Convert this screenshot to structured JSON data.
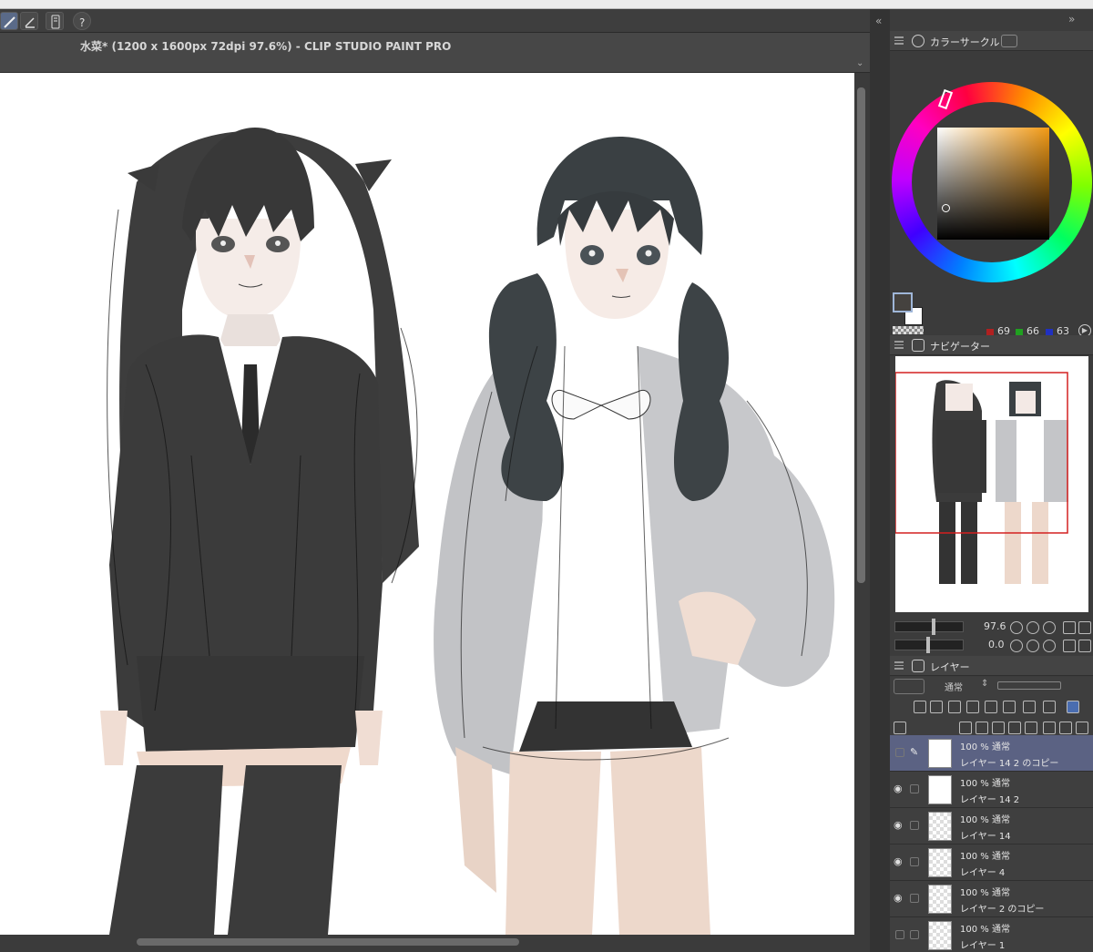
{
  "menubar": {
    "text": "",
    "clock": ""
  },
  "document": {
    "title": "水菜* (1200 x 1600px 72dpi 97.6%)  - CLIP STUDIO PAINT PRO"
  },
  "color_panel": {
    "title": "カラーサークル",
    "r": "69",
    "g": "66",
    "b": "63",
    "main_color": "#45423f",
    "accent": "#d98a1a"
  },
  "navigator": {
    "title": "ナビゲーター",
    "zoom": "97.6",
    "rotation": "0.0"
  },
  "layers": {
    "title": "レイヤー",
    "blend": "通常",
    "items": [
      {
        "mode": "100 % 通常",
        "name": "レイヤー 14 2 のコピー"
      },
      {
        "mode": "100 % 通常",
        "name": "レイヤー 14 2"
      },
      {
        "mode": "100 % 通常",
        "name": "レイヤー 14"
      },
      {
        "mode": "100 % 通常",
        "name": "レイヤー 4"
      },
      {
        "mode": "100 % 通常",
        "name": "レイヤー 2 のコピー"
      },
      {
        "mode": "100 % 通常",
        "name": "レイヤー 1"
      }
    ]
  }
}
